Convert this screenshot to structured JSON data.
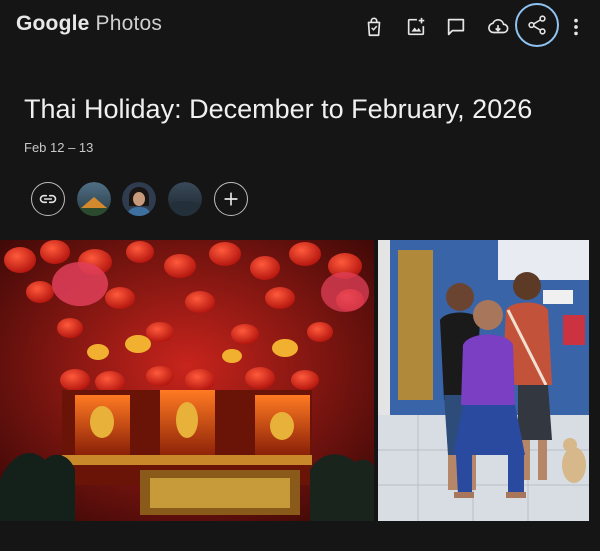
{
  "header": {
    "brand_google": "Google",
    "brand_photos": "Photos",
    "actions": [
      {
        "name": "shopping-bag-icon"
      },
      {
        "name": "add-photo-icon"
      },
      {
        "name": "comment-icon"
      },
      {
        "name": "cloud-download-icon"
      },
      {
        "name": "share-icon",
        "highlighted": true
      },
      {
        "name": "more-vert-icon"
      }
    ]
  },
  "album": {
    "title": "Thai Holiday: December to February, 2026",
    "date_range": "Feb 12 – 13"
  },
  "sharing": {
    "items": [
      "link-icon",
      "avatar-landscape",
      "avatar-woman",
      "avatar-dark",
      "add-icon"
    ]
  },
  "photos": [
    {
      "name": "photo-red-lantern-shrine"
    },
    {
      "name": "photo-family-group"
    }
  ],
  "colors": {
    "background": "#151515",
    "text": "#f0f0f0",
    "highlight_ring": "#8fc3f2"
  }
}
